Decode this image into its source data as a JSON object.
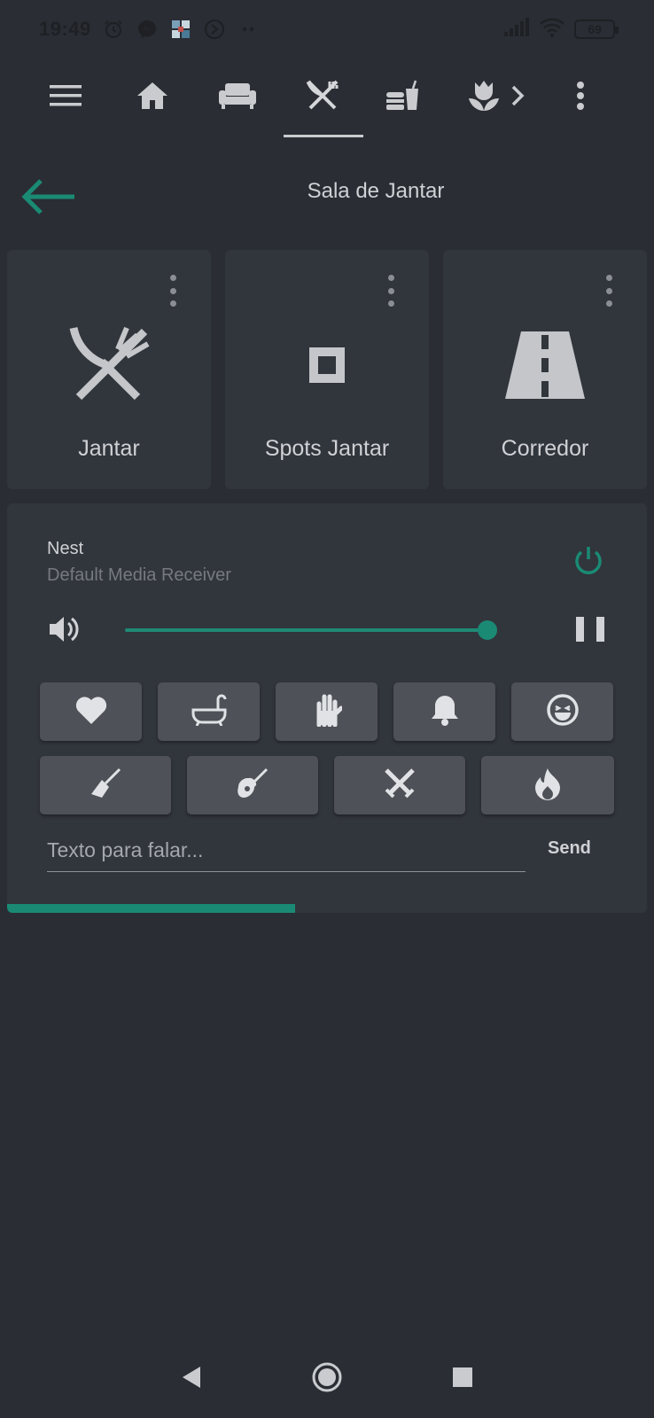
{
  "status_bar": {
    "time": "19:49",
    "battery": "69",
    "icons": [
      "alarm-icon",
      "messenger-icon",
      "app-icon",
      "sync-icon",
      "dots-icon",
      "signal-icon",
      "wifi-icon"
    ]
  },
  "tabs": [
    {
      "name": "menu-icon"
    },
    {
      "name": "home-icon"
    },
    {
      "name": "sofa-icon"
    },
    {
      "name": "silverware-icon",
      "active": true
    },
    {
      "name": "food-drink-icon"
    },
    {
      "name": "flower-icon"
    },
    {
      "name": "chevron-right-icon"
    },
    {
      "name": "more-vertical-icon"
    }
  ],
  "header": {
    "title": "Sala de Jantar"
  },
  "cards": [
    {
      "label": "Jantar",
      "icon": "silverware-icon"
    },
    {
      "label": "Spots Jantar",
      "icon": "square-outline-icon"
    },
    {
      "label": "Corredor",
      "icon": "road-icon"
    }
  ],
  "media": {
    "name": "Nest",
    "subtitle": "Default Media Receiver",
    "volume": 1.0,
    "quick_buttons_row1": [
      "heart-icon",
      "bathtub-icon",
      "hand-icon",
      "bell-icon",
      "smile-icon"
    ],
    "quick_buttons_row2": [
      "broom-icon",
      "guitar-icon",
      "swords-icon",
      "fire-icon"
    ],
    "tts_placeholder": "Texto para falar...",
    "send_label": "Send",
    "progress": 0.45
  },
  "colors": {
    "background": "#2a2d34",
    "card": "#31353c",
    "accent": "#1a8a74",
    "quick_button": "#4e5157"
  }
}
